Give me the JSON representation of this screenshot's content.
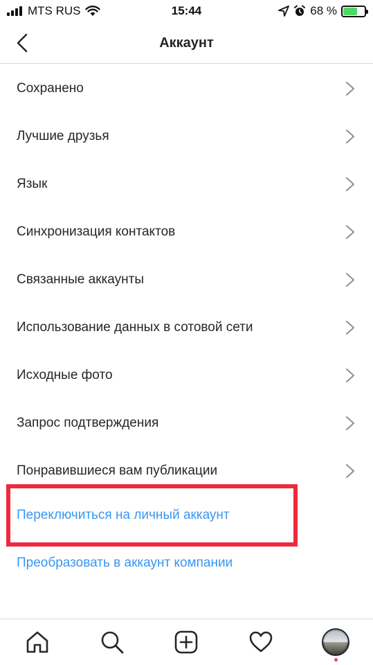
{
  "status_bar": {
    "carrier": "MTS RUS",
    "time": "15:44",
    "battery_text": "68 %",
    "battery_level": 0.68,
    "battery_color": "#4cd964"
  },
  "header": {
    "title": "Аккаунт",
    "back_icon": "chevron-left-icon"
  },
  "menu": {
    "items": [
      {
        "label": "Сохранено"
      },
      {
        "label": "Лучшие друзья"
      },
      {
        "label": "Язык"
      },
      {
        "label": "Синхронизация контактов"
      },
      {
        "label": "Связанные аккаунты"
      },
      {
        "label": "Использование данных в сотовой сети"
      },
      {
        "label": "Исходные фото"
      },
      {
        "label": "Запрос подтверждения"
      },
      {
        "label": "Понравившиеся вам публикации"
      }
    ]
  },
  "links": {
    "switch_personal": "Переключиться на личный аккаунт",
    "convert_business": "Преобразовать в аккаунт компании",
    "link_color": "#3897f0",
    "highlight_color": "#ee2a3c"
  },
  "tab_bar": {
    "icons": [
      "home-icon",
      "search-icon",
      "add-post-icon",
      "heart-icon",
      "profile-avatar"
    ]
  }
}
